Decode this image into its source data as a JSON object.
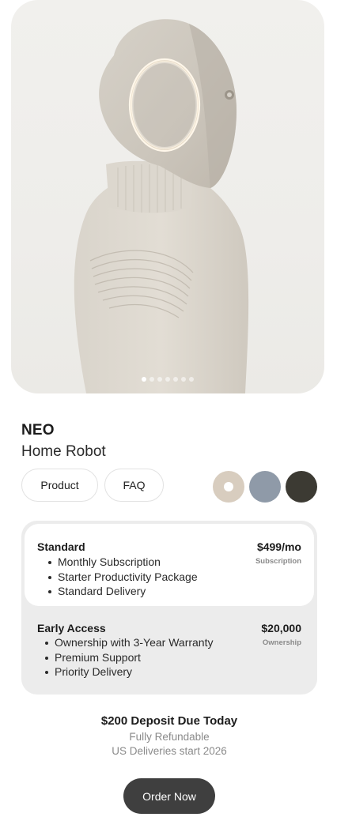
{
  "hero": {
    "image_alt": "NEO humanoid robot in beige knit suit, side profile",
    "slide_count": 7,
    "active_slide": 1
  },
  "product": {
    "name": "NEO",
    "subtitle": "Home Robot"
  },
  "tabs": {
    "product_label": "Product",
    "faq_label": "FAQ"
  },
  "colors": [
    {
      "name": "cream",
      "hex": "#d8cdbf",
      "selected": true
    },
    {
      "name": "blue-gray",
      "hex": "#8f9aa8",
      "selected": false
    },
    {
      "name": "dark-olive",
      "hex": "#3c3a33",
      "selected": false
    }
  ],
  "plans": {
    "standard": {
      "name": "Standard",
      "price": "$499/mo",
      "type": "Subscription",
      "features": [
        "Monthly Subscription",
        "Starter Productivity Package",
        "Standard Delivery"
      ]
    },
    "early_access": {
      "name": "Early Access",
      "price": "$20,000",
      "type": "Ownership",
      "features": [
        "Ownership with 3-Year Warranty",
        "Premium Support",
        "Priority Delivery"
      ]
    }
  },
  "checkout": {
    "deposit": "$200 Deposit Due Today",
    "refundable": "Fully Refundable",
    "delivery_note": "US Deliveries start 2026",
    "order_label": "Order Now"
  }
}
